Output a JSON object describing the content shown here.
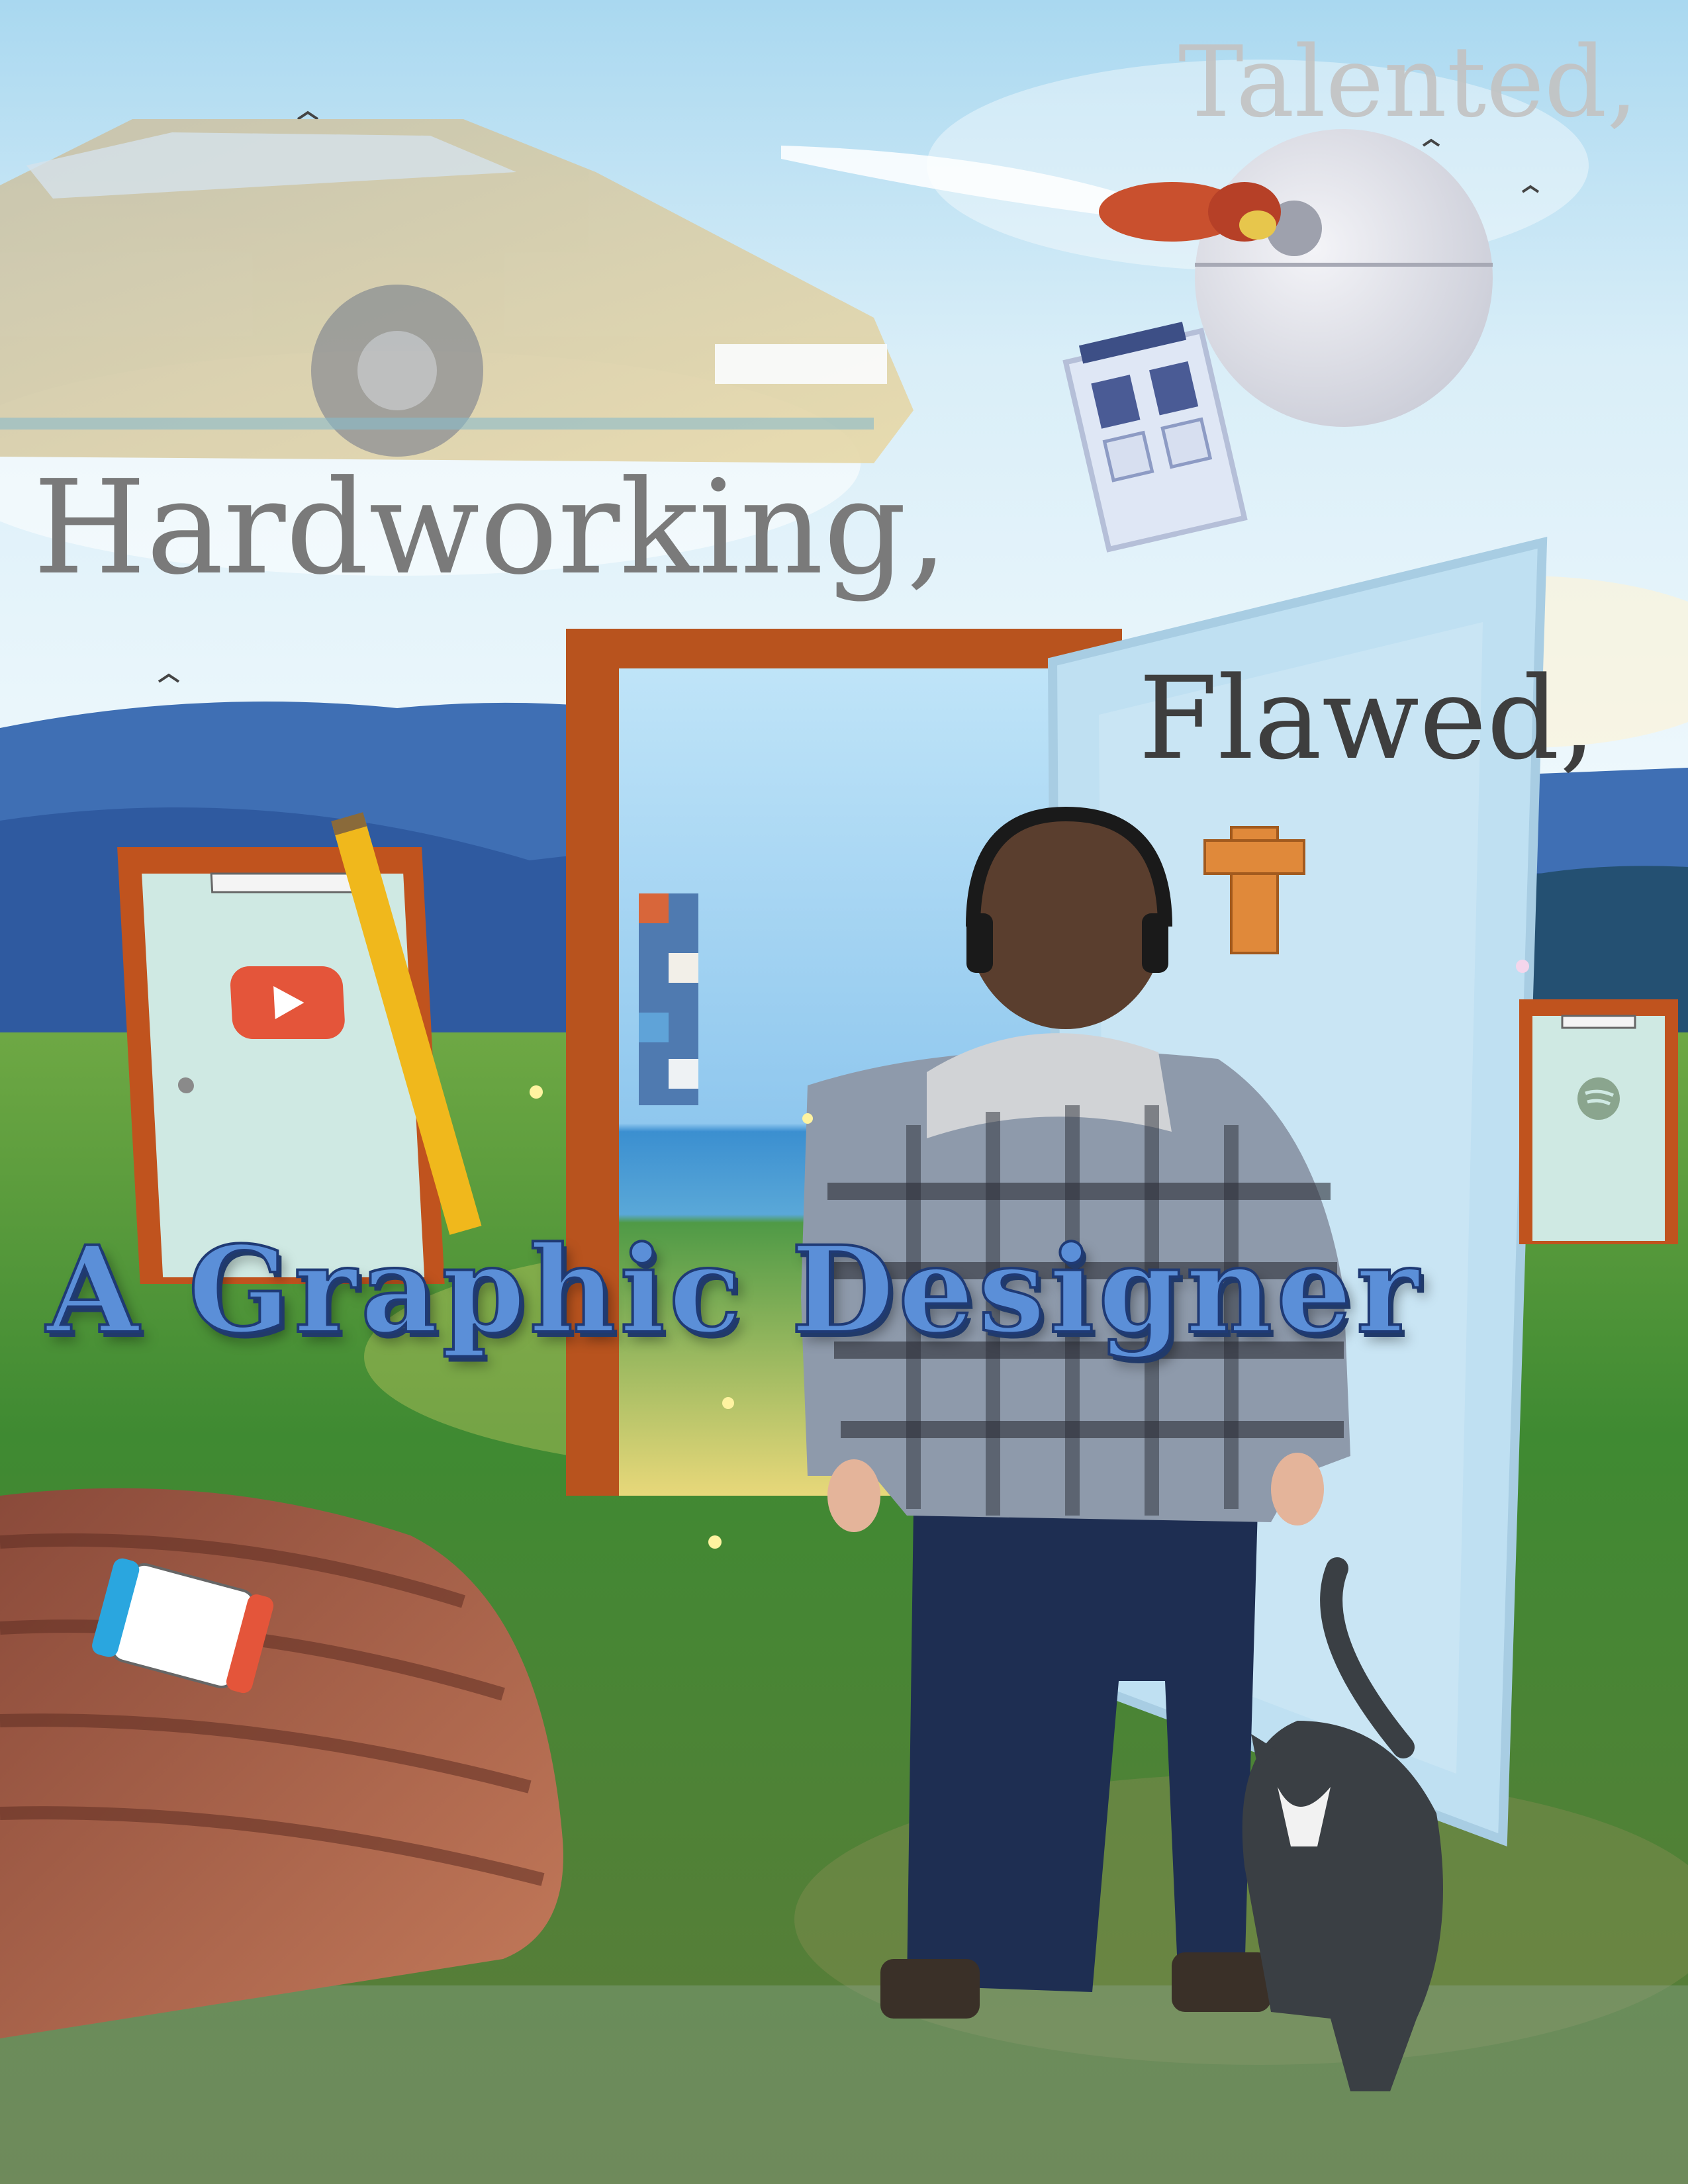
{
  "captions": {
    "line1": "Talented,",
    "line2": "Hardworking,",
    "line3": "Flawed,",
    "headline": "A Graphic Designer"
  },
  "colors": {
    "sky_top": "#a9d8f0",
    "sky_bottom": "#eef8fc",
    "mountains": "#3f6fb4",
    "grass": "#3f8a32",
    "door_frame": "#b8531e",
    "door_panel": "#bfe0f2",
    "headline_fill": "#5b8fd8",
    "headline_outline": "#1f3a75"
  },
  "icons": {
    "youtube_door": "youtube-play-icon",
    "spotify_door": "spotify-icon",
    "handheld_console": "game-console-icon"
  }
}
